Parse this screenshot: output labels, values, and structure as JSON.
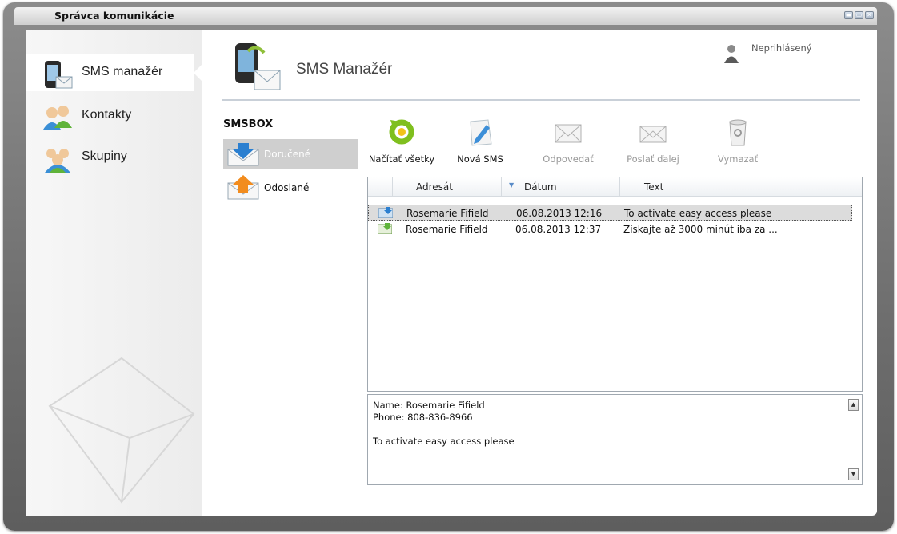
{
  "window": {
    "title": "Správca komunikácie",
    "controls": [
      "minimize",
      "maximize",
      "close"
    ]
  },
  "sidebar": {
    "items": [
      {
        "label": "SMS manažér",
        "icon": "phone-icon",
        "active": true
      },
      {
        "label": "Kontakty",
        "icon": "contacts-icon",
        "active": false
      },
      {
        "label": "Skupiny",
        "icon": "groups-icon",
        "active": false
      }
    ]
  },
  "header": {
    "title": "SMS Manažér",
    "user_status": "Neprihlásený"
  },
  "smsbox": {
    "title": "SMSBOX",
    "folders": [
      {
        "label": "Doručené",
        "icon": "inbox-icon",
        "selected": true
      },
      {
        "label": "Odoslané",
        "icon": "outbox-icon",
        "selected": false
      }
    ]
  },
  "toolbar": {
    "buttons": [
      {
        "label": "Načítať všetky",
        "icon": "refresh-icon",
        "enabled": true
      },
      {
        "label": "Nová SMS",
        "icon": "new-sms-icon",
        "enabled": true
      },
      {
        "label": "Odpovedať",
        "icon": "reply-icon",
        "enabled": false
      },
      {
        "label": "Poslať ďalej",
        "icon": "forward-icon",
        "enabled": false
      },
      {
        "label": "Vymazať",
        "icon": "trash-icon",
        "enabled": false
      }
    ]
  },
  "messages": {
    "columns": [
      "Adresát",
      "Dátum",
      "Text"
    ],
    "sort_column": "Dátum",
    "rows": [
      {
        "recipient": "Rosemarie Fifield",
        "date": "06.08.2013 12:16",
        "text": "To activate easy access please",
        "selected": true
      },
      {
        "recipient": "Rosemarie Fifield",
        "date": "06.08.2013 12:37",
        "text": "Získajte až 3000 minút iba za ...",
        "selected": false
      }
    ]
  },
  "detail": {
    "name_line": "Name: Rosemarie Fifield",
    "phone_line": "Phone: 808-836-8966",
    "body": "To activate easy access please"
  },
  "colors": {
    "frame": "#7a7a7a",
    "selected_folder": "#cfcfcf",
    "accent_blue": "#2b7fd0",
    "accent_orange": "#f28c1e",
    "refresh_green": "#7fbf1e"
  }
}
